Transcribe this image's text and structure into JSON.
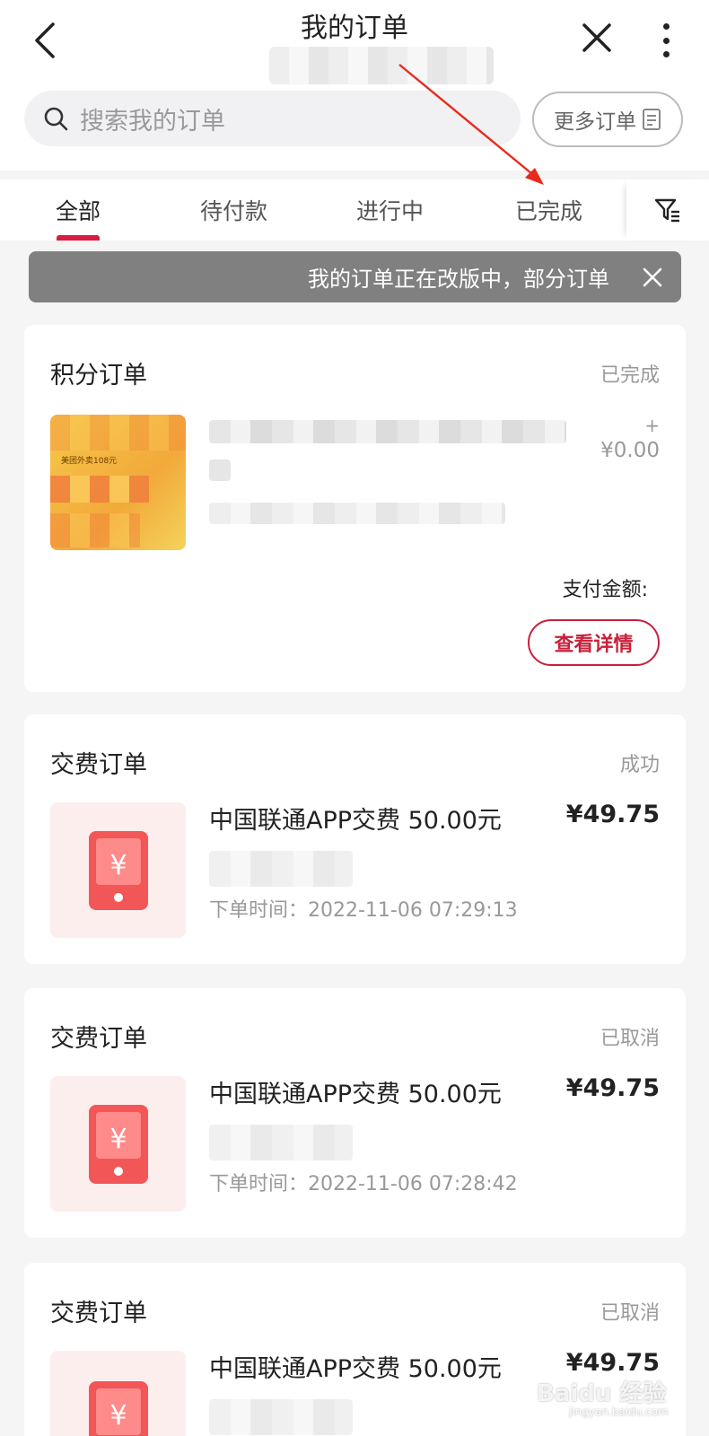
{
  "header": {
    "title": "我的订单",
    "back_icon": "chevron-left-icon",
    "close_icon": "close-icon",
    "more_icon": "more-vertical-icon"
  },
  "search": {
    "placeholder": "搜索我的订单",
    "more_orders_label": "更多订单"
  },
  "tabs": [
    {
      "label": "全部",
      "active": true
    },
    {
      "label": "待付款",
      "active": false
    },
    {
      "label": "进行中",
      "active": false
    },
    {
      "label": "已完成",
      "active": false
    }
  ],
  "notice": {
    "text": "我的订单正在改版中，部分订单"
  },
  "orders": [
    {
      "type": "积分订单",
      "status": "已完成",
      "coupon_text": "美团外卖108元",
      "plus": "+",
      "price": "¥0.00",
      "pay_label": "支付金额:",
      "detail_label": "查看详情"
    },
    {
      "type": "交费订单",
      "status": "成功",
      "name": "中国联通APP交费 50.00元",
      "price": "¥49.75",
      "time": "下单时间：2022-11-06 07:29:13"
    },
    {
      "type": "交费订单",
      "status": "已取消",
      "name": "中国联通APP交费 50.00元",
      "price": "¥49.75",
      "time": "下单时间：2022-11-06 07:28:42"
    },
    {
      "type": "交费订单",
      "status": "已取消",
      "name": "中国联通APP交费 50.00元",
      "price": "¥49.75"
    }
  ],
  "watermark": {
    "brand": "Baidu 经验",
    "url": "jingyan.baidu.com"
  },
  "colors": {
    "accent": "#d81e40",
    "button_red": "#c8203a",
    "annotation_arrow": "#e8291c"
  }
}
